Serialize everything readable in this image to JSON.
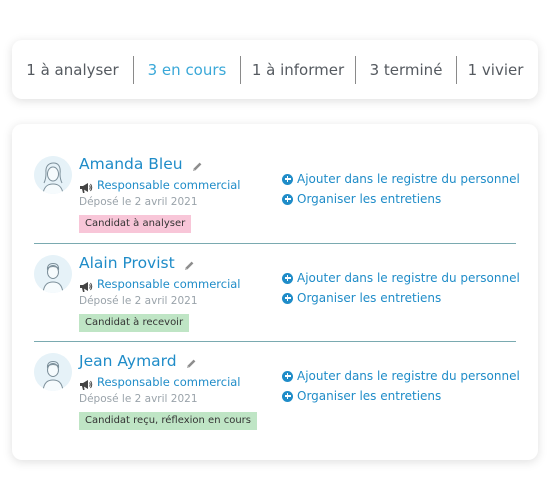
{
  "tabs": [
    {
      "label": "1 à analyser",
      "active": false
    },
    {
      "label": "3 en cours",
      "active": true
    },
    {
      "label": "1 à informer",
      "active": false
    },
    {
      "label": "3 terminé",
      "active": false
    },
    {
      "label": "1 vivier",
      "active": false
    }
  ],
  "candidates": [
    {
      "name": "Amanda Bleu",
      "role": "Responsable commercial",
      "date": "Déposé le 2 avril 2021",
      "status": "Candidat à analyser",
      "status_color": "#f8c6d8",
      "actions": [
        "Ajouter dans le registre du personnel",
        "Organiser les entretiens"
      ]
    },
    {
      "name": "Alain Provist",
      "role": "Responsable commercial",
      "date": "Déposé le 2 avril 2021",
      "status": "Candidat à recevoir",
      "status_color": "#bfe5c5",
      "actions": [
        "Ajouter dans le registre du personnel",
        "Organiser les entretiens"
      ]
    },
    {
      "name": "Jean Aymard",
      "role": "Responsable commercial",
      "date": "Déposé le 2 avril 2021",
      "status": "Candidat reçu, réflexion en cours",
      "status_color": "#bfe5c5",
      "actions": [
        "Ajouter dans le registre du personnel",
        "Organiser les entretiens"
      ]
    }
  ],
  "colors": {
    "accent": "#1f8cc8",
    "active_tab": "#3aa8d8"
  },
  "icons": {
    "edit": "pencil-icon",
    "role": "megaphone-icon",
    "action": "plus-circle-icon",
    "avatar": "user-avatar-icon"
  }
}
